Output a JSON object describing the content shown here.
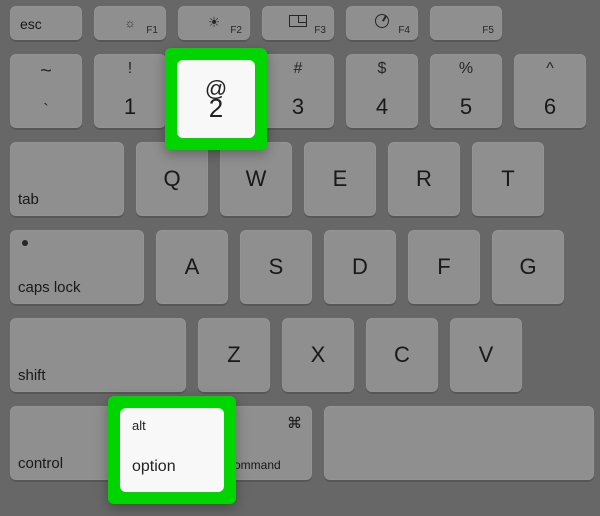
{
  "fn_row": {
    "esc": "esc",
    "f1": {
      "label": "F1",
      "icon": "brightness-low"
    },
    "f2": {
      "label": "F2",
      "icon": "brightness-high"
    },
    "f3": {
      "label": "F3",
      "icon": "mission-control"
    },
    "f4": {
      "label": "F4",
      "icon": "gauge"
    },
    "f5": {
      "label": "F5",
      "icon": ""
    }
  },
  "num_row": {
    "tilde": {
      "top": "~",
      "main": "`"
    },
    "k1": {
      "top": "!",
      "main": "1"
    },
    "k2": {
      "top": "@",
      "main": "2"
    },
    "k3": {
      "top": "#",
      "main": "3"
    },
    "k4": {
      "top": "$",
      "main": "4"
    },
    "k5": {
      "top": "%",
      "main": "5"
    },
    "k6": {
      "top": "^",
      "main": "6"
    }
  },
  "row_q": {
    "tab": "tab",
    "q": "Q",
    "w": "W",
    "e": "E",
    "r": "R",
    "t": "T"
  },
  "row_a": {
    "caps": "caps lock",
    "a": "A",
    "s": "S",
    "d": "D",
    "f": "F",
    "g": "G"
  },
  "row_z": {
    "shift": "shift",
    "z": "Z",
    "x": "X",
    "c": "C",
    "v": "V"
  },
  "bottom_row": {
    "control": "control",
    "option": {
      "alt": "alt",
      "label": "option"
    },
    "command": {
      "label": "command",
      "glyph": "⌘"
    }
  },
  "highlights": {
    "two": {
      "top": "@",
      "main": "2"
    },
    "option": {
      "alt": "alt",
      "label": "option"
    }
  }
}
